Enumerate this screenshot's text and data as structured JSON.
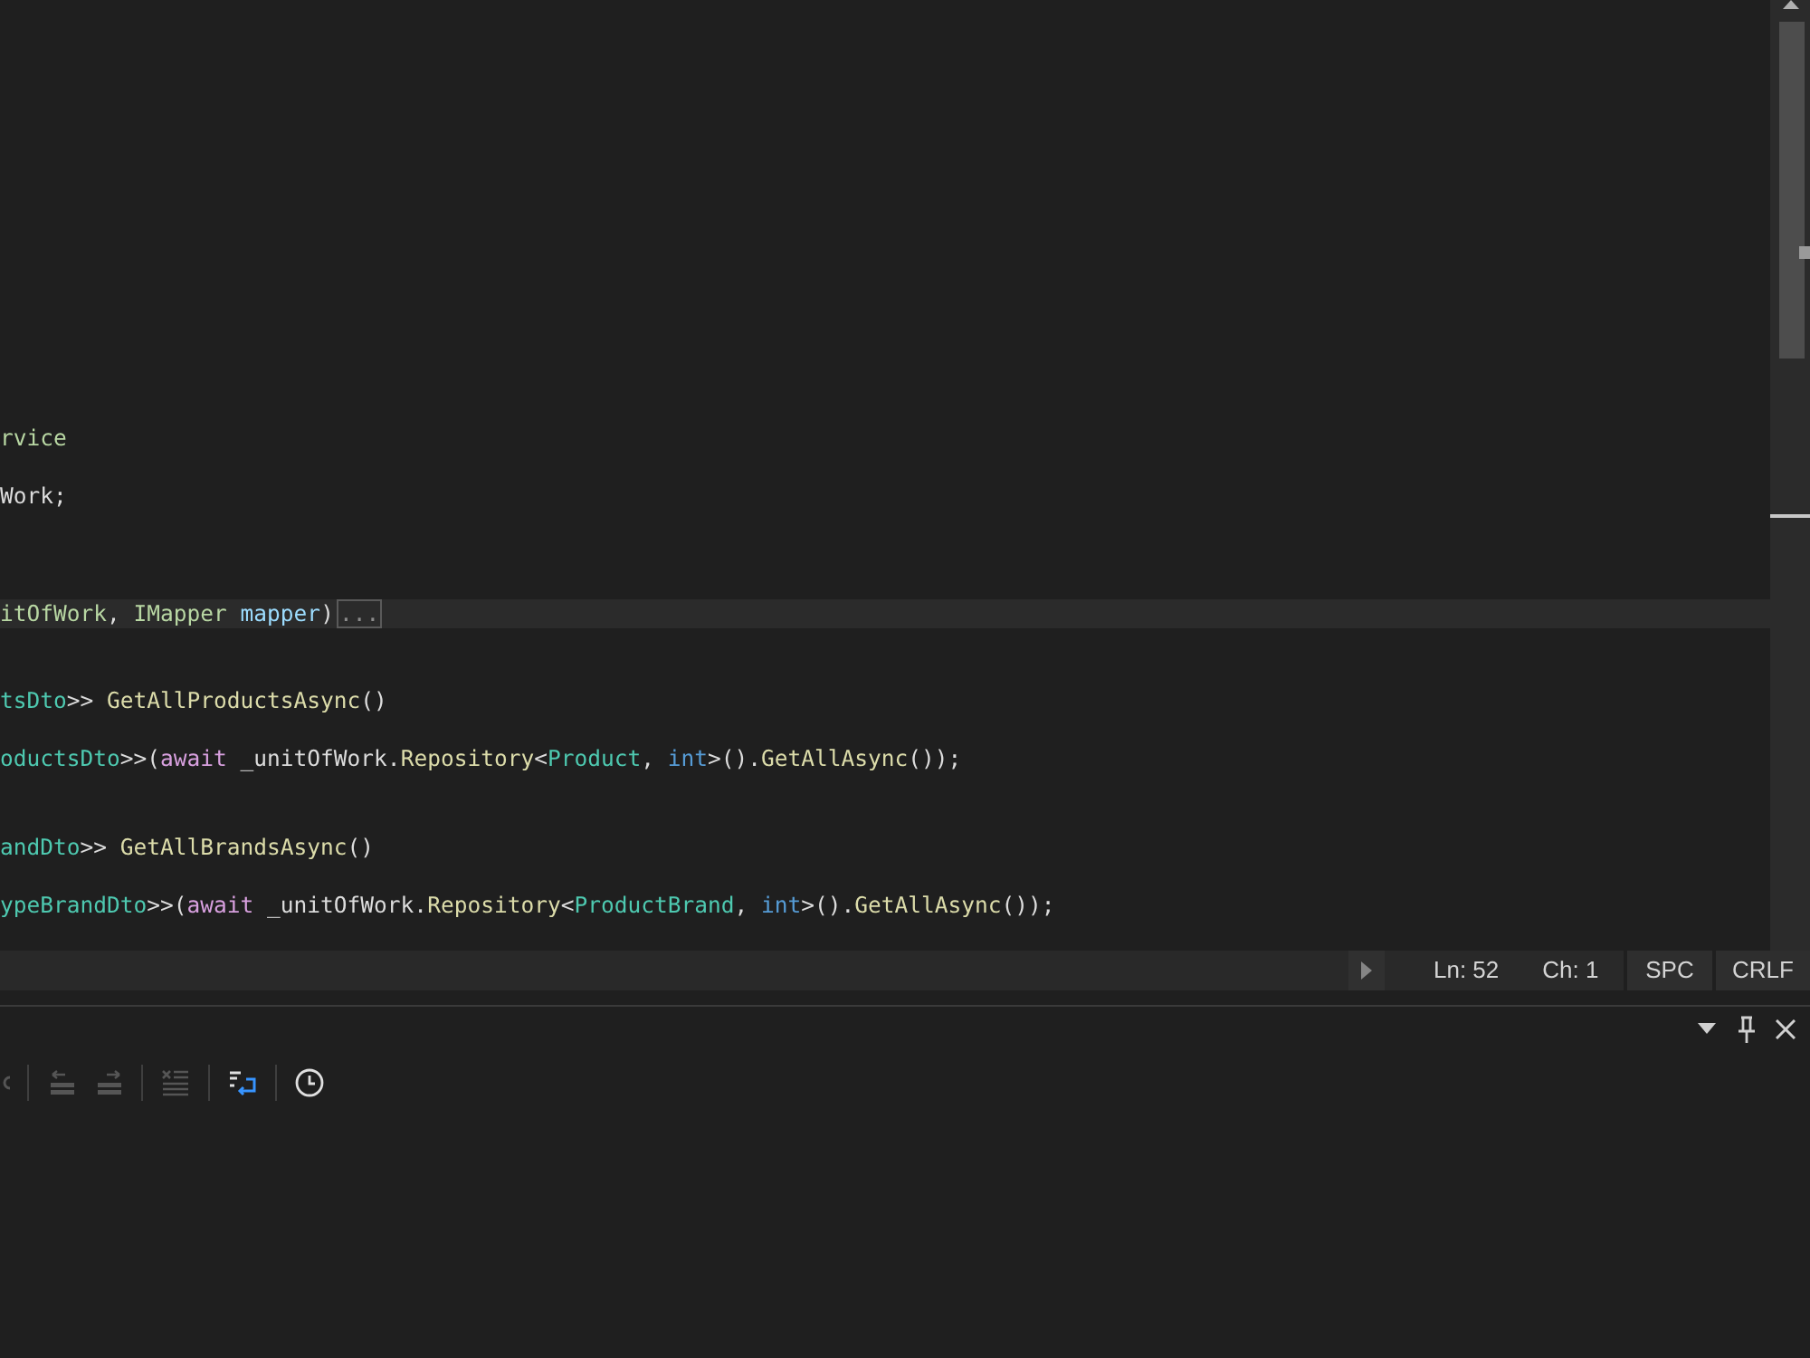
{
  "editor": {
    "lines": [
      {
        "current": false,
        "tokens": [
          {
            "kind": "interface",
            "text": "rvice"
          }
        ]
      },
      {
        "current": false,
        "tokens": [
          {
            "kind": "plain",
            "text": "Work;"
          }
        ]
      },
      {
        "current": true,
        "tokens": [
          {
            "kind": "interface",
            "text": "itOfWork"
          },
          {
            "kind": "plain",
            "text": ", "
          },
          {
            "kind": "interface",
            "text": "IMapper"
          },
          {
            "kind": "param",
            "text": " mapper"
          },
          {
            "kind": "plain",
            "text": ")"
          }
        ],
        "fold_marker": "..."
      },
      {
        "current": false,
        "tokens": [
          {
            "kind": "class",
            "text": "tsDto"
          },
          {
            "kind": "plain",
            "text": ">> "
          },
          {
            "kind": "method",
            "text": "GetAllProductsAsync"
          },
          {
            "kind": "plain",
            "text": "()"
          }
        ]
      },
      {
        "current": false,
        "tokens": [
          {
            "kind": "class",
            "text": "oductsDto"
          },
          {
            "kind": "plain",
            "text": ">>("
          },
          {
            "kind": "control",
            "text": "await"
          },
          {
            "kind": "plain",
            "text": " _unitOfWork."
          },
          {
            "kind": "method",
            "text": "Repository"
          },
          {
            "kind": "plain",
            "text": "<"
          },
          {
            "kind": "class",
            "text": "Product"
          },
          {
            "kind": "plain",
            "text": ", "
          },
          {
            "kind": "keyword",
            "text": "int"
          },
          {
            "kind": "plain",
            "text": ">()."
          },
          {
            "kind": "method",
            "text": "GetAllAsync"
          },
          {
            "kind": "plain",
            "text": "());"
          }
        ]
      },
      {
        "current": false,
        "tokens": [
          {
            "kind": "class",
            "text": "andDto"
          },
          {
            "kind": "plain",
            "text": ">> "
          },
          {
            "kind": "method",
            "text": "GetAllBrandsAsync"
          },
          {
            "kind": "plain",
            "text": "()"
          }
        ]
      },
      {
        "current": false,
        "tokens": [
          {
            "kind": "class",
            "text": "ypeBrandDto"
          },
          {
            "kind": "plain",
            "text": ">>("
          },
          {
            "kind": "control",
            "text": "await"
          },
          {
            "kind": "plain",
            "text": " _unitOfWork."
          },
          {
            "kind": "method",
            "text": "Repository"
          },
          {
            "kind": "plain",
            "text": "<"
          },
          {
            "kind": "class",
            "text": "ProductBrand"
          },
          {
            "kind": "plain",
            "text": ", "
          },
          {
            "kind": "keyword",
            "text": "int"
          },
          {
            "kind": "plain",
            "text": ">()."
          },
          {
            "kind": "method",
            "text": "GetAllAsync"
          },
          {
            "kind": "plain",
            "text": "());"
          }
        ]
      }
    ]
  },
  "status_bar": {
    "line": "Ln: 52",
    "column": "Ch: 1",
    "indentation": "SPC",
    "line_ending": "CRLF"
  },
  "output_panel": {
    "toolbar": {
      "groups": [
        {
          "buttons": [
            {
              "kind": "arc",
              "disabled": true
            }
          ]
        },
        {
          "buttons": [
            {
              "kind": "arrow-left",
              "disabled": true
            },
            {
              "kind": "arrow-right",
              "disabled": true
            }
          ]
        },
        {
          "buttons": [
            {
              "kind": "cross-lines",
              "disabled": true
            }
          ]
        },
        {
          "buttons": [
            {
              "kind": "wrap",
              "disabled": false
            }
          ]
        },
        {
          "buttons": [
            {
              "kind": "clock",
              "disabled": false
            }
          ]
        }
      ]
    }
  }
}
